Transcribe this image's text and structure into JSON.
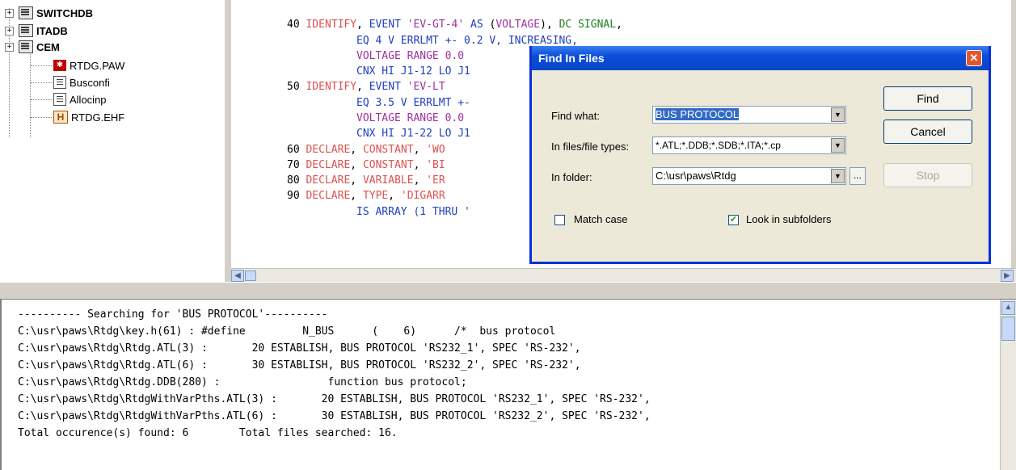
{
  "tree": {
    "items": [
      {
        "label": "SWITCHDB",
        "bold": true
      },
      {
        "label": "ITADB",
        "bold": true
      },
      {
        "label": "CEM",
        "bold": true
      },
      {
        "label": "RTDG.PAW"
      },
      {
        "label": "Busconfi"
      },
      {
        "label": "Allocinp"
      },
      {
        "label": "RTDG.EHF"
      }
    ],
    "expander_glyph": "+"
  },
  "code": {
    "lines": [
      {
        "n": "40",
        "parts": [
          "IDENTIFY",
          ", ",
          "EVENT",
          " ",
          "'EV-GT-4'",
          " ",
          "AS",
          " (",
          "VOLTAGE",
          "), ",
          "DC SIGNAL",
          ","
        ]
      },
      {
        "indent": "EQ 4 V ERRLMT +- 0.2 V, INCREASING,"
      },
      {
        "indent": "VOLTAGE RANGE 0.0 "
      },
      {
        "indent": "CNX HI J1-12 LO J1"
      },
      {
        "n": "50",
        "parts": [
          "IDENTIFY",
          ", ",
          "EVENT",
          " ",
          "'EV-LT",
          "",
          "",
          "",
          "",
          "",
          "",
          ""
        ]
      },
      {
        "indent": "EQ 3.5 V ERRLMT +-"
      },
      {
        "indent": "VOLTAGE RANGE 0.0 "
      },
      {
        "indent": "CNX HI J1-22 LO J1"
      },
      {
        "n": "60",
        "kw": "DECLARE",
        "rest": "CONSTANT",
        "str": "'WO"
      },
      {
        "n": "70",
        "kw": "DECLARE",
        "rest": "CONSTANT",
        "str": "'BI"
      },
      {
        "n": "80",
        "kw": "DECLARE",
        "rest": "VARIABLE",
        "str": "'ER"
      },
      {
        "n": "90",
        "kw": "DECLARE",
        "rest": "TYPE",
        "str": "'DIGARR"
      },
      {
        "indent": "IS ARRAY (1 THRU '"
      }
    ]
  },
  "output": {
    "lines": [
      "---------- Searching for 'BUS PROTOCOL'----------",
      "C:\\usr\\paws\\Rtdg\\key.h(61) : #define         N_BUS      (    6)      /*  bus protocol",
      "C:\\usr\\paws\\Rtdg\\Rtdg.ATL(3) :       20 ESTABLISH, BUS PROTOCOL 'RS232_1', SPEC 'RS-232',",
      "C:\\usr\\paws\\Rtdg\\Rtdg.ATL(6) :       30 ESTABLISH, BUS PROTOCOL 'RS232_2', SPEC 'RS-232',",
      "C:\\usr\\paws\\Rtdg\\Rtdg.DDB(280) :                 function bus protocol;",
      "C:\\usr\\paws\\Rtdg\\RtdgWithVarPths.ATL(3) :       20 ESTABLISH, BUS PROTOCOL 'RS232_1', SPEC 'RS-232',",
      "C:\\usr\\paws\\Rtdg\\RtdgWithVarPths.ATL(6) :       30 ESTABLISH, BUS PROTOCOL 'RS232_2', SPEC 'RS-232',",
      "Total occurence(s) found: 6        Total files searched: 16."
    ]
  },
  "dialog": {
    "title": "Find In Files",
    "close_glyph": "✕",
    "find_what_label": "Find what:",
    "find_what_value": "BUS PROTOCOL",
    "file_types_label": "In files/file types:",
    "file_types_value": "*.ATL;*.DDB;*.SDB;*.ITA;*.cp",
    "folder_label": "In folder:",
    "folder_value": "C:\\usr\\paws\\Rtdg",
    "browse_label": "...",
    "match_case_label": "Match case",
    "match_case_checked": false,
    "subfolders_label": "Look in subfolders",
    "subfolders_checked": true,
    "find_button": "Find",
    "cancel_button": "Cancel",
    "stop_button": "Stop",
    "dropdown_glyph": "▼",
    "check_glyph": "✔"
  },
  "scroll": {
    "left_glyph": "◀",
    "right_glyph": "▶",
    "up_glyph": "▲"
  },
  "colors": {
    "keyword": "#e05050",
    "identifier": "#2040c0",
    "string": "#a030a0",
    "signal": "#208020",
    "title_bar": "#0a4ed8"
  }
}
